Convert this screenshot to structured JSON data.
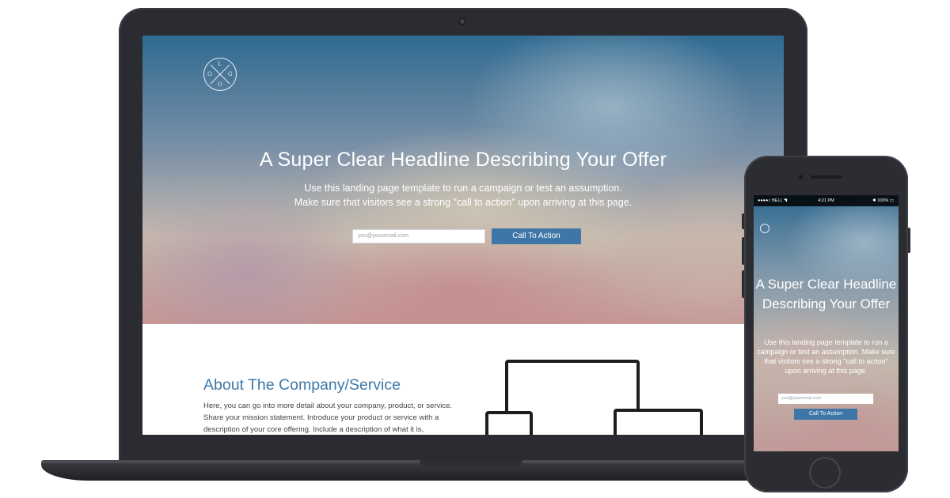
{
  "laptop": {
    "hero": {
      "logo_letters": [
        "L",
        "O",
        "G",
        "O"
      ],
      "headline": "A Super Clear Headline Describing Your Offer",
      "subheadline_line1": "Use this landing page template to run a campaign or test an assumption.",
      "subheadline_line2": "Make sure that visitors see a strong \"call to action\" upon arriving at this page.",
      "email_placeholder": "you@youremail.com",
      "cta_label": "Call To Action"
    },
    "about": {
      "title": "About The Company/Service",
      "text": "Here, you can go into more detail about your company, product, or service. Share your mission statement. Introduce your product or service with a description of your core offering. Include a description of what it is,"
    }
  },
  "phone": {
    "status": {
      "carrier": "●●●●○ BELL ◥",
      "time": "4:21 PM",
      "battery": "✱ 100% ▭"
    },
    "headline": "A Super Clear Headline Describing Your Offer",
    "subheadline": "Use this landing page template to run a campaign or test an assumption. Make sure that visitors see a strong \"call to action\" upon arriving at this page.",
    "email_placeholder": "you@youremail.com",
    "cta_label": "Call To Action"
  },
  "colors": {
    "accent": "#3e76a8",
    "device_frame": "#2b2c31"
  },
  "icons": [
    "logo-circle-icon",
    "devices-illustration-icon",
    "wifi-icon",
    "battery-icon"
  ]
}
